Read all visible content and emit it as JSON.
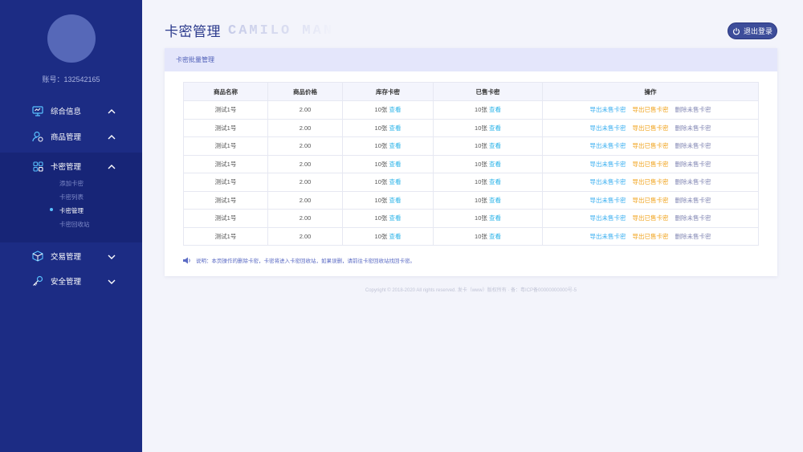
{
  "sidebar": {
    "account": "账号：132542165",
    "items": [
      {
        "label": "综合信息",
        "icon": "monitor-icon"
      },
      {
        "label": "商品管理",
        "icon": "user-goods-icon"
      },
      {
        "label": "卡密管理",
        "icon": "grid-icon"
      },
      {
        "label": "交易管理",
        "icon": "box-icon"
      },
      {
        "label": "安全管理",
        "icon": "key-icon"
      }
    ],
    "submenu": [
      "添加卡密",
      "卡密列表",
      "卡密管理",
      "卡密回收站"
    ]
  },
  "header": {
    "title": "卡密管理",
    "brand": "CAMILO MAN",
    "logout": "退出登录"
  },
  "card": {
    "title": "卡密批量管理",
    "columns": [
      "商品名称",
      "商品价格",
      "库存卡密",
      "已售卡密",
      "操作"
    ],
    "rows": [
      {
        "name": "测试1号",
        "price": "2.00",
        "stock": "10张",
        "sold": "10张"
      },
      {
        "name": "测试1号",
        "price": "2.00",
        "stock": "10张",
        "sold": "10张"
      },
      {
        "name": "测试1号",
        "price": "2.00",
        "stock": "10张",
        "sold": "10张"
      },
      {
        "name": "测试1号",
        "price": "2.00",
        "stock": "10张",
        "sold": "10张"
      },
      {
        "name": "测试1号",
        "price": "2.00",
        "stock": "10张",
        "sold": "10张"
      },
      {
        "name": "测试1号",
        "price": "2.00",
        "stock": "10张",
        "sold": "10张"
      },
      {
        "name": "测试1号",
        "price": "2.00",
        "stock": "10张",
        "sold": "10张"
      },
      {
        "name": "测试1号",
        "price": "2.00",
        "stock": "10张",
        "sold": "10张"
      }
    ],
    "view_label": "查看",
    "actions": [
      "导出未售卡密",
      "导出已售卡密",
      "删除未售卡密"
    ],
    "note": "说明：本页操作的删除卡密，卡密将进入卡密回收站，如果误删，请前往卡密回收站找回卡密。"
  },
  "footer": "Copyright © 2018-2020 All rights reserved. 发卡（www）版权所有 · 备：粤ICP备00000000000号-5",
  "colors": {
    "sidebar": "#1c2c84",
    "accent": "#2b3a8c",
    "export_unsold": "#37aef0",
    "export_sold": "#f0a21a",
    "delete": "#8186b3"
  }
}
